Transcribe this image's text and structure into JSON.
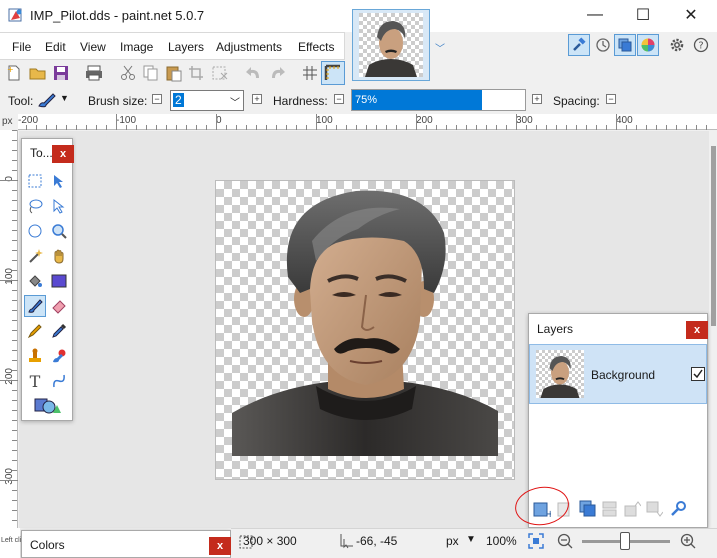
{
  "window": {
    "title": "IMP_Pilot.dds - paint.net 5.0.7",
    "minimize": "—",
    "maximize": "☐",
    "close": "✕"
  },
  "menu": [
    "File",
    "Edit",
    "View",
    "Image",
    "Layers",
    "Adjustments",
    "Effects"
  ],
  "options": {
    "tool_label": "Tool:",
    "brush_size_label": "Brush size:",
    "brush_size_value": "2",
    "hardness_label": "Hardness:",
    "hardness_value": "75%",
    "hardness_fraction": 0.75,
    "spacing_label": "Spacing:"
  },
  "ruler": {
    "unit": "px",
    "top_labels": [
      "-200",
      "-100",
      "0",
      "100",
      "200",
      "300",
      "400"
    ],
    "left_labels": [
      "0",
      "100",
      "200",
      "300"
    ]
  },
  "tools_window": {
    "title": "To...",
    "close": "x"
  },
  "layers_window": {
    "title": "Layers",
    "close": "x",
    "layers": [
      {
        "name": "Background",
        "visible": true
      }
    ]
  },
  "colors_window": {
    "title": "Colors",
    "close": "x"
  },
  "status": {
    "image_size": "300 × 300",
    "cursor_pos": "-66, -45",
    "unit": "px",
    "zoom": "100%",
    "hint_left": "Left cli"
  },
  "colors": {
    "accent": "#0078d7",
    "close_red": "#c42b1c",
    "annotation": "#e01515"
  }
}
